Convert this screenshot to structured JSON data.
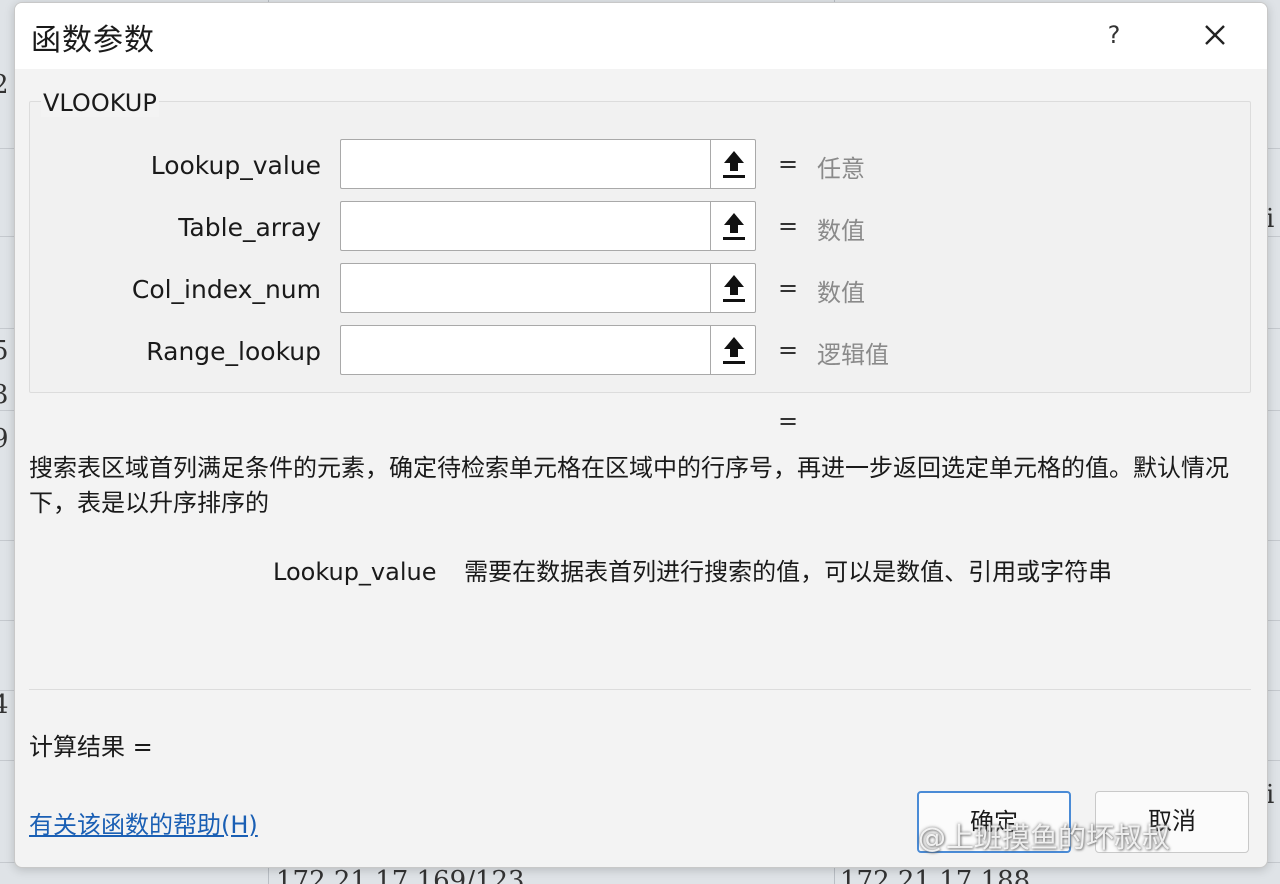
{
  "background": {
    "cell_texts": [
      "2",
      "5",
      "3",
      "9",
      "4",
      "i",
      "i",
      "172.21.17.169/123",
      "172.21.17.188"
    ]
  },
  "dialog": {
    "title": "函数参数",
    "help_symbol": "?",
    "function_name": "VLOOKUP",
    "args": [
      {
        "label": "Lookup_value",
        "value": "",
        "equals": "=",
        "type": "任意"
      },
      {
        "label": "Table_array",
        "value": "",
        "equals": "=",
        "type": "数值"
      },
      {
        "label": "Col_index_num",
        "value": "",
        "equals": "=",
        "type": "数值"
      },
      {
        "label": "Range_lookup",
        "value": "",
        "equals": "=",
        "type": "逻辑值"
      }
    ],
    "result_equals": "=",
    "description": "搜索表区域首列满足条件的元素，确定待检索单元格在区域中的行序号，再进一步返回选定单元格的值。默认情况下，表是以升序排序的",
    "arg_help": {
      "name": "Lookup_value",
      "text": "需要在数据表首列进行搜索的值，可以是数值、引用或字符串"
    },
    "calc_result_label": "计算结果 =",
    "help_link": "有关该函数的帮助(H)",
    "ok_button": "确定",
    "cancel_button": "取消"
  },
  "watermark": "@上班摸鱼的坏叔叔",
  "icons": {
    "close": "close-icon",
    "collapse": "upload-arrow-icon"
  },
  "colors": {
    "link": "#1a5fb4",
    "ok_border": "#4a8bd6",
    "type_hint": "#8a8a8a"
  }
}
